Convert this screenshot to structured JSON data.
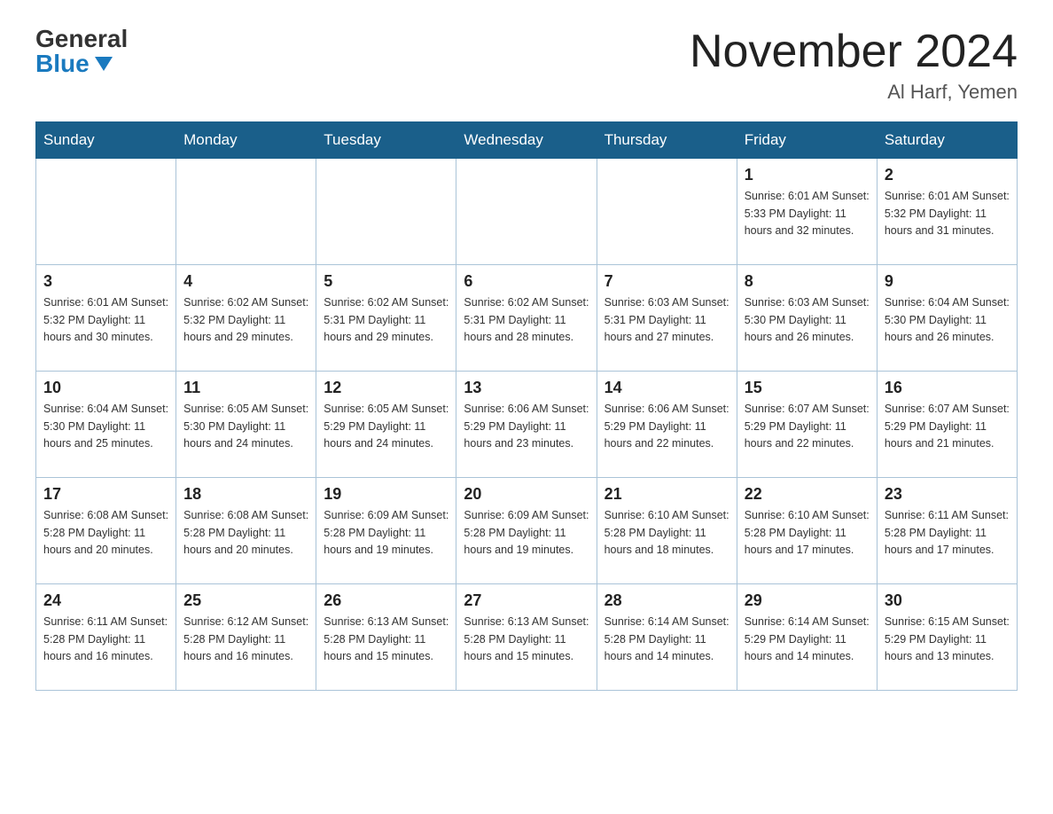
{
  "header": {
    "logo_general": "General",
    "logo_blue": "Blue",
    "month_title": "November 2024",
    "location": "Al Harf, Yemen"
  },
  "days_of_week": [
    "Sunday",
    "Monday",
    "Tuesday",
    "Wednesday",
    "Thursday",
    "Friday",
    "Saturday"
  ],
  "weeks": [
    [
      {
        "day": "",
        "info": ""
      },
      {
        "day": "",
        "info": ""
      },
      {
        "day": "",
        "info": ""
      },
      {
        "day": "",
        "info": ""
      },
      {
        "day": "",
        "info": ""
      },
      {
        "day": "1",
        "info": "Sunrise: 6:01 AM\nSunset: 5:33 PM\nDaylight: 11 hours and 32 minutes."
      },
      {
        "day": "2",
        "info": "Sunrise: 6:01 AM\nSunset: 5:32 PM\nDaylight: 11 hours and 31 minutes."
      }
    ],
    [
      {
        "day": "3",
        "info": "Sunrise: 6:01 AM\nSunset: 5:32 PM\nDaylight: 11 hours and 30 minutes."
      },
      {
        "day": "4",
        "info": "Sunrise: 6:02 AM\nSunset: 5:32 PM\nDaylight: 11 hours and 29 minutes."
      },
      {
        "day": "5",
        "info": "Sunrise: 6:02 AM\nSunset: 5:31 PM\nDaylight: 11 hours and 29 minutes."
      },
      {
        "day": "6",
        "info": "Sunrise: 6:02 AM\nSunset: 5:31 PM\nDaylight: 11 hours and 28 minutes."
      },
      {
        "day": "7",
        "info": "Sunrise: 6:03 AM\nSunset: 5:31 PM\nDaylight: 11 hours and 27 minutes."
      },
      {
        "day": "8",
        "info": "Sunrise: 6:03 AM\nSunset: 5:30 PM\nDaylight: 11 hours and 26 minutes."
      },
      {
        "day": "9",
        "info": "Sunrise: 6:04 AM\nSunset: 5:30 PM\nDaylight: 11 hours and 26 minutes."
      }
    ],
    [
      {
        "day": "10",
        "info": "Sunrise: 6:04 AM\nSunset: 5:30 PM\nDaylight: 11 hours and 25 minutes."
      },
      {
        "day": "11",
        "info": "Sunrise: 6:05 AM\nSunset: 5:30 PM\nDaylight: 11 hours and 24 minutes."
      },
      {
        "day": "12",
        "info": "Sunrise: 6:05 AM\nSunset: 5:29 PM\nDaylight: 11 hours and 24 minutes."
      },
      {
        "day": "13",
        "info": "Sunrise: 6:06 AM\nSunset: 5:29 PM\nDaylight: 11 hours and 23 minutes."
      },
      {
        "day": "14",
        "info": "Sunrise: 6:06 AM\nSunset: 5:29 PM\nDaylight: 11 hours and 22 minutes."
      },
      {
        "day": "15",
        "info": "Sunrise: 6:07 AM\nSunset: 5:29 PM\nDaylight: 11 hours and 22 minutes."
      },
      {
        "day": "16",
        "info": "Sunrise: 6:07 AM\nSunset: 5:29 PM\nDaylight: 11 hours and 21 minutes."
      }
    ],
    [
      {
        "day": "17",
        "info": "Sunrise: 6:08 AM\nSunset: 5:28 PM\nDaylight: 11 hours and 20 minutes."
      },
      {
        "day": "18",
        "info": "Sunrise: 6:08 AM\nSunset: 5:28 PM\nDaylight: 11 hours and 20 minutes."
      },
      {
        "day": "19",
        "info": "Sunrise: 6:09 AM\nSunset: 5:28 PM\nDaylight: 11 hours and 19 minutes."
      },
      {
        "day": "20",
        "info": "Sunrise: 6:09 AM\nSunset: 5:28 PM\nDaylight: 11 hours and 19 minutes."
      },
      {
        "day": "21",
        "info": "Sunrise: 6:10 AM\nSunset: 5:28 PM\nDaylight: 11 hours and 18 minutes."
      },
      {
        "day": "22",
        "info": "Sunrise: 6:10 AM\nSunset: 5:28 PM\nDaylight: 11 hours and 17 minutes."
      },
      {
        "day": "23",
        "info": "Sunrise: 6:11 AM\nSunset: 5:28 PM\nDaylight: 11 hours and 17 minutes."
      }
    ],
    [
      {
        "day": "24",
        "info": "Sunrise: 6:11 AM\nSunset: 5:28 PM\nDaylight: 11 hours and 16 minutes."
      },
      {
        "day": "25",
        "info": "Sunrise: 6:12 AM\nSunset: 5:28 PM\nDaylight: 11 hours and 16 minutes."
      },
      {
        "day": "26",
        "info": "Sunrise: 6:13 AM\nSunset: 5:28 PM\nDaylight: 11 hours and 15 minutes."
      },
      {
        "day": "27",
        "info": "Sunrise: 6:13 AM\nSunset: 5:28 PM\nDaylight: 11 hours and 15 minutes."
      },
      {
        "day": "28",
        "info": "Sunrise: 6:14 AM\nSunset: 5:28 PM\nDaylight: 11 hours and 14 minutes."
      },
      {
        "day": "29",
        "info": "Sunrise: 6:14 AM\nSunset: 5:29 PM\nDaylight: 11 hours and 14 minutes."
      },
      {
        "day": "30",
        "info": "Sunrise: 6:15 AM\nSunset: 5:29 PM\nDaylight: 11 hours and 13 minutes."
      }
    ]
  ]
}
